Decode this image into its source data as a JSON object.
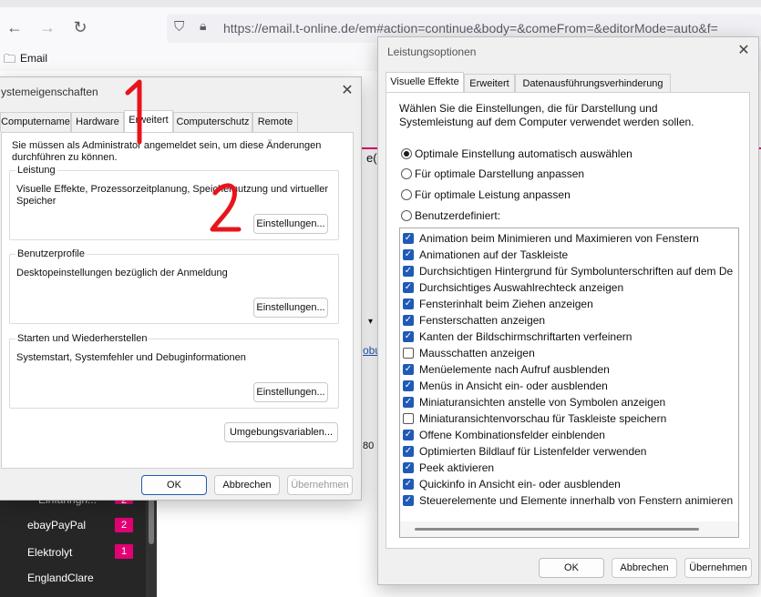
{
  "browser": {
    "url": "https://email.t-online.de/em#action=continue&body=&comeFrom=&editorMode=auto&f=",
    "bookmark_label": "Email",
    "zoom_partial": "80"
  },
  "background": {
    "partial_text_e": "e(",
    "partial_link": "obu",
    "partial_number": "80",
    "folders": [
      {
        "label": "ebayPayPal",
        "count": "2"
      },
      {
        "label": "Elektrolyt",
        "count": "1"
      },
      {
        "label": "EnglandClare",
        "count": ""
      }
    ],
    "partial_folder": "Einfahrign...",
    "partial_folder_count": "2"
  },
  "system_props": {
    "title": "ystemeigenschaften",
    "tabs": [
      "Computername",
      "Hardware",
      "Erweitert",
      "Computerschutz",
      "Remote"
    ],
    "admin_note": "Sie müssen als Administrator angemeldet sein, um diese Änderungen durchführen zu können.",
    "performance": {
      "title": "Leistung",
      "text": "Visuelle Effekte, Prozessorzeitplanung, Speichernutzung und virtueller Speicher",
      "button": "Einstellungen..."
    },
    "profiles": {
      "title": "Benutzerprofile",
      "text": "Desktopeinstellungen bezüglich der Anmeldung",
      "button": "Einstellungen..."
    },
    "startup": {
      "title": "Starten und Wiederherstellen",
      "text": "Systemstart, Systemfehler und Debuginformationen",
      "button": "Einstellungen..."
    },
    "env_button": "Umgebungsvariablen...",
    "ok": "OK",
    "cancel": "Abbrechen",
    "apply": "Übernehmen"
  },
  "perf_options": {
    "title": "Leistungsoptionen",
    "tabs": [
      "Visuelle Effekte",
      "Erweitert",
      "Datenausführungsverhinderung"
    ],
    "intro": "Wählen Sie die Einstellungen, die für Darstellung und Systemleistung auf dem Computer verwendet werden sollen.",
    "radios": [
      {
        "label": "Optimale Einstellung automatisch auswählen",
        "checked": true
      },
      {
        "label": "Für optimale Darstellung anpassen",
        "checked": false
      },
      {
        "label": "Für optimale Leistung anpassen",
        "checked": false
      },
      {
        "label": "Benutzerdefiniert:",
        "checked": false
      }
    ],
    "effects": [
      {
        "label": "Animation beim Minimieren und Maximieren von Fenstern",
        "checked": true
      },
      {
        "label": "Animationen auf der Taskleiste",
        "checked": true
      },
      {
        "label": "Durchsichtigen Hintergrund für Symbolunterschriften auf dem De",
        "checked": true
      },
      {
        "label": "Durchsichtiges Auswahlrechteck anzeigen",
        "checked": true
      },
      {
        "label": "Fensterinhalt beim Ziehen anzeigen",
        "checked": true
      },
      {
        "label": "Fensterschatten anzeigen",
        "checked": true
      },
      {
        "label": "Kanten der Bildschirmschriftarten verfeinern",
        "checked": true
      },
      {
        "label": "Mausschatten anzeigen",
        "checked": false
      },
      {
        "label": "Menüelemente nach Aufruf ausblenden",
        "checked": true
      },
      {
        "label": "Menüs in Ansicht ein- oder ausblenden",
        "checked": true
      },
      {
        "label": "Miniaturansichten anstelle von Symbolen anzeigen",
        "checked": true
      },
      {
        "label": "Miniaturansichtenvorschau für Taskleiste speichern",
        "checked": false
      },
      {
        "label": "Offene Kombinationsfelder einblenden",
        "checked": true
      },
      {
        "label": "Optimierten Bildlauf für Listenfelder verwenden",
        "checked": true
      },
      {
        "label": "Peek aktivieren",
        "checked": true
      },
      {
        "label": "Quickinfo in Ansicht ein- oder ausblenden",
        "checked": true
      },
      {
        "label": "Steuerelemente und Elemente innerhalb von Fenstern animieren",
        "checked": true
      }
    ],
    "ok": "OK",
    "cancel": "Abbrechen",
    "apply": "Übernehmen"
  },
  "annotations": [
    "1",
    "2"
  ],
  "colors": {
    "accent": "#1f5bb5",
    "annotation": "#e8141c",
    "badge": "#e20074"
  }
}
